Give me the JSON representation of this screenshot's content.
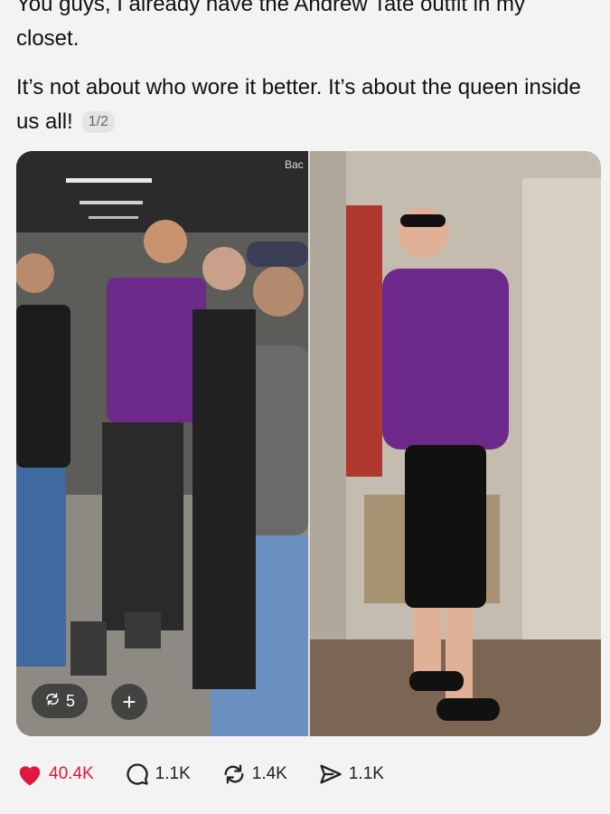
{
  "post": {
    "line1": "You guys, I already have the Andrew Tate outfit in my",
    "line2": "closet.",
    "para2": "It’s not about who wore it better. It’s about the queen inside us all!",
    "page_indicator": "1/2"
  },
  "media": {
    "photo_left_text": "Bac",
    "repost_count": "5",
    "add_symbol": "+"
  },
  "actions": {
    "likes": "40.4K",
    "replies": "1.1K",
    "reposts": "1.4K",
    "shares": "1.1K"
  },
  "colors": {
    "like": "#e0183c",
    "background": "#f3f3f3"
  },
  "icons": [
    "heart-icon",
    "comment-icon",
    "repost-icon",
    "share-icon",
    "plus-icon"
  ]
}
